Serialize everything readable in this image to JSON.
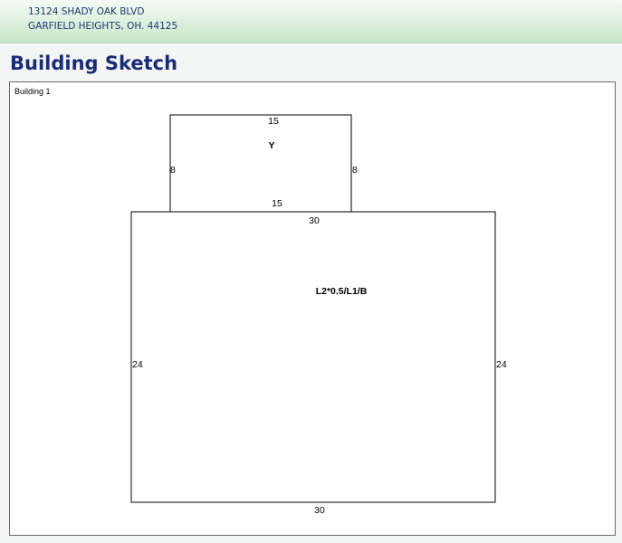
{
  "header": {
    "address_line1": "13124 SHADY OAK BLVD",
    "address_line2": "GARFIELD HEIGHTS, OH. 44125"
  },
  "page": {
    "title": "Building Sketch"
  },
  "sketch": {
    "building_label": "Building 1",
    "upper_section": {
      "area_label": "Y",
      "top_dim": "15",
      "bottom_dim": "15",
      "left_dim": "8",
      "right_dim": "8"
    },
    "main_section": {
      "area_label": "L2*0.5/L1/B",
      "top_dim": "30",
      "bottom_dim": "30",
      "left_dim": "24",
      "right_dim": "24"
    }
  },
  "colors": {
    "header_gradient_top": "#f4fbf4",
    "header_gradient_bottom": "#c6e6c8",
    "address_text": "#1e3a6a",
    "title_text": "#1a2a7a"
  }
}
